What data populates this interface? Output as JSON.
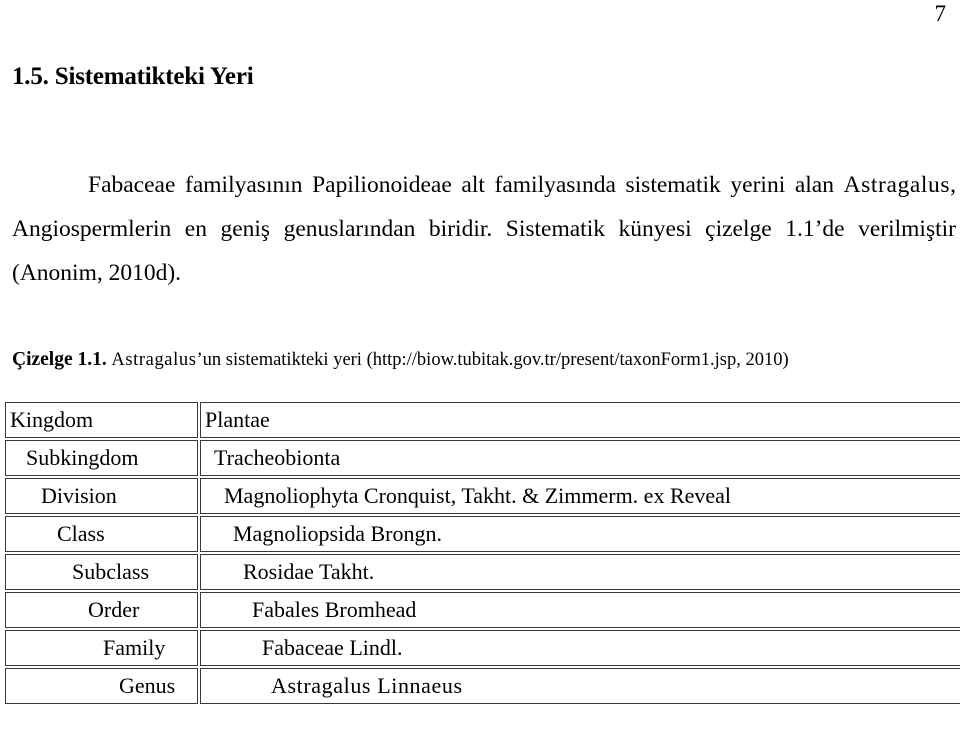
{
  "page": {
    "number": "7"
  },
  "heading": {
    "text": "1.5. Sistematikteki Yeri"
  },
  "paragraph": {
    "part1": "Fabaceae familyasının Papilionoideae alt familyasında sistematik yerini alan ",
    "genus_inline": "Astragalus",
    "part2": ", Angiospermlerin en geniş genuslarından biridir. Sistematik künyesi çizelge 1.1’de verilmiştir (Anonim, 2010d)."
  },
  "caption": {
    "label": "Çizelge 1.1.",
    "genus": "Astragalus",
    "text_after_genus": "’un sistematikteki yeri (http://biow.tubitak.gov.tr/present/taxonForm1.jsp, 2010)",
    "url": "http://biow.tubitak.gov.tr/present/taxonForm1.jsp",
    "year": "2010"
  },
  "taxonomy_table": {
    "rows": [
      {
        "rank": "Kingdom",
        "rank_indent": 0,
        "name": "Plantae",
        "name_indent": 0
      },
      {
        "rank": "Subkingdom",
        "rank_indent": 16,
        "name": "Tracheobionta",
        "name_indent": 9
      },
      {
        "rank": "Division",
        "rank_indent": 31,
        "name": "Magnoliophyta  Cronquist, Takht. & Zimmerm. ex Reveal",
        "name_indent": 19
      },
      {
        "rank": "Class",
        "rank_indent": 47,
        "name": "Magnoliopsida  Brongn.",
        "name_indent": 28
      },
      {
        "rank": "Subclass",
        "rank_indent": 62,
        "name": "Rosidae Takht.",
        "name_indent": 38
      },
      {
        "rank": "Order",
        "rank_indent": 78,
        "name": "Fabales Bromhead",
        "name_indent": 47
      },
      {
        "rank": "Family",
        "rank_indent": 93,
        "name": "Fabaceae Lindl.",
        "name_indent": 57
      },
      {
        "rank": "Genus",
        "rank_indent": 109,
        "name": "Astragalus Linnaeus",
        "name_indent": 66
      }
    ]
  }
}
